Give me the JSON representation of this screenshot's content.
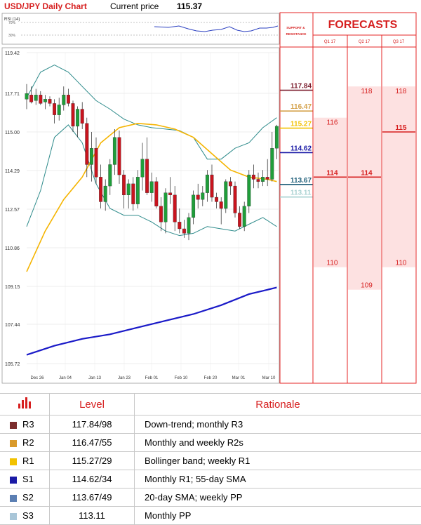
{
  "header": {
    "title": "USD/JPY Daily Chart",
    "price_label": "Current price",
    "price_value": "115.37"
  },
  "rsi_label": "RSI (14)",
  "rsi_ticks": [
    "70%",
    "30%"
  ],
  "sr_header": "SUPPORT & RESISTANCE",
  "forecast_title": "FORECASTS",
  "forecast_cols": [
    "Q1 17",
    "Q2 17",
    "Q3 17"
  ],
  "chart_data": {
    "type": "candlestick",
    "y_ticks": [
      "119.42",
      "117.71",
      "115.00",
      "114.29",
      "112.57",
      "110.86",
      "109.15",
      "107.44",
      "105.72"
    ],
    "x_ticks": [
      "Dec 26",
      "Jan 04",
      "Jan 13",
      "Jan 23",
      "Feb 01",
      "Feb 10",
      "Feb 20",
      "Mar 01",
      "Mar 10"
    ],
    "ylim": [
      105.72,
      119.42
    ],
    "series": [
      {
        "name": "Candles",
        "values": [
          [
            117.3,
            118.1,
            116.6,
            117.7
          ],
          [
            117.6,
            118.0,
            117.0,
            117.1
          ],
          [
            117.2,
            117.9,
            116.9,
            117.6
          ],
          [
            117.6,
            117.8,
            116.9,
            117.0
          ],
          [
            117.1,
            117.6,
            116.6,
            117.3
          ],
          [
            117.3,
            117.5,
            116.8,
            117.0
          ],
          [
            117.0,
            117.3,
            115.6,
            116.2
          ],
          [
            116.2,
            117.4,
            115.8,
            116.9
          ],
          [
            116.9,
            118.0,
            116.5,
            117.6
          ],
          [
            117.6,
            117.9,
            116.8,
            117.0
          ],
          [
            117.0,
            117.2,
            115.0,
            115.4
          ],
          [
            115.4,
            116.8,
            114.9,
            116.6
          ],
          [
            116.6,
            117.1,
            115.2,
            115.6
          ],
          [
            115.6,
            116.0,
            114.0,
            114.4
          ],
          [
            114.4,
            115.0,
            113.8,
            114.7
          ],
          [
            114.7,
            114.9,
            113.7,
            114.0
          ],
          [
            114.0,
            114.4,
            112.6,
            112.9
          ],
          [
            112.9,
            113.9,
            112.5,
            113.6
          ],
          [
            113.6,
            114.5,
            113.2,
            114.4
          ],
          [
            114.4,
            115.2,
            114.1,
            114.9
          ],
          [
            114.9,
            115.1,
            113.7,
            114.1
          ],
          [
            114.1,
            114.3,
            112.6,
            113.2
          ],
          [
            113.2,
            113.9,
            112.6,
            113.7
          ],
          [
            113.7,
            114.0,
            112.5,
            112.8
          ],
          [
            112.8,
            114.3,
            112.6,
            114.0
          ],
          [
            114.0,
            114.8,
            113.4,
            114.5
          ],
          [
            114.5,
            114.9,
            113.2,
            113.3
          ],
          [
            113.3,
            114.2,
            112.9,
            113.8
          ],
          [
            113.8,
            114.0,
            112.6,
            112.7
          ],
          [
            112.7,
            113.1,
            111.6,
            112.0
          ],
          [
            112.0,
            113.5,
            111.5,
            113.3
          ],
          [
            113.3,
            114.0,
            112.8,
            113.2
          ],
          [
            113.2,
            113.6,
            111.6,
            112.0
          ],
          [
            112.0,
            112.6,
            111.5,
            111.7
          ],
          [
            111.7,
            112.1,
            111.3,
            111.5
          ],
          [
            111.5,
            112.4,
            111.2,
            112.2
          ],
          [
            112.2,
            113.4,
            111.9,
            113.2
          ],
          [
            113.2,
            113.7,
            112.6,
            113.0
          ],
          [
            113.0,
            113.6,
            112.7,
            113.3
          ],
          [
            113.3,
            114.3,
            112.9,
            114.1
          ],
          [
            114.1,
            114.4,
            112.9,
            113.1
          ],
          [
            113.1,
            113.3,
            112.6,
            112.9
          ],
          [
            112.9,
            113.1,
            111.9,
            112.6
          ],
          [
            112.6,
            113.9,
            112.4,
            113.8
          ],
          [
            113.8,
            114.0,
            113.2,
            113.6
          ],
          [
            113.6,
            113.8,
            112.2,
            112.4
          ],
          [
            112.4,
            112.7,
            111.7,
            111.8
          ],
          [
            111.8,
            112.9,
            111.6,
            112.7
          ],
          [
            112.7,
            114.3,
            112.4,
            114.1
          ],
          [
            114.1,
            114.4,
            113.5,
            113.9
          ],
          [
            113.9,
            114.2,
            113.5,
            113.8
          ],
          [
            113.8,
            114.3,
            113.6,
            114.0
          ],
          [
            114.0,
            114.5,
            113.6,
            113.9
          ],
          [
            113.9,
            115.0,
            113.8,
            114.7
          ],
          [
            114.7,
            115.5,
            114.5,
            115.4
          ]
        ]
      },
      {
        "name": "SMA",
        "values": [
          [
            0,
            109.8
          ],
          [
            4,
            111.6
          ],
          [
            8,
            113.0
          ],
          [
            12,
            114.0
          ],
          [
            16,
            114.8
          ],
          [
            20,
            115.3
          ],
          [
            24,
            115.6
          ],
          [
            28,
            115.5
          ],
          [
            32,
            115.2
          ],
          [
            36,
            114.9
          ],
          [
            40,
            114.6
          ],
          [
            44,
            114.3
          ],
          [
            48,
            114.0
          ],
          [
            52,
            113.9
          ],
          [
            54,
            113.8
          ]
        ]
      },
      {
        "name": "BB upper",
        "values": [
          [
            0,
            117.4
          ],
          [
            3,
            118.6
          ],
          [
            6,
            118.9
          ],
          [
            9,
            118.6
          ],
          [
            12,
            118.0
          ],
          [
            15,
            117.2
          ],
          [
            18,
            116.6
          ],
          [
            21,
            115.9
          ],
          [
            24,
            115.5
          ],
          [
            27,
            115.3
          ],
          [
            30,
            115.2
          ],
          [
            33,
            115.1
          ],
          [
            36,
            114.9
          ],
          [
            39,
            114.5
          ],
          [
            42,
            114.5
          ],
          [
            45,
            114.7
          ],
          [
            48,
            114.8
          ],
          [
            51,
            115.3
          ],
          [
            54,
            116.0
          ]
        ]
      },
      {
        "name": "BB lower",
        "values": [
          [
            0,
            111.8
          ],
          [
            3,
            113.4
          ],
          [
            6,
            114.9
          ],
          [
            9,
            115.5
          ],
          [
            12,
            114.8
          ],
          [
            15,
            113.7
          ],
          [
            18,
            112.6
          ],
          [
            21,
            112.3
          ],
          [
            24,
            112.3
          ],
          [
            27,
            112.0
          ],
          [
            30,
            111.6
          ],
          [
            33,
            111.4
          ],
          [
            36,
            111.5
          ],
          [
            39,
            111.8
          ],
          [
            42,
            111.7
          ],
          [
            45,
            111.6
          ],
          [
            48,
            111.9
          ],
          [
            51,
            112.2
          ],
          [
            54,
            111.8
          ]
        ]
      },
      {
        "name": "Long MA",
        "values": [
          [
            0,
            106.1
          ],
          [
            6,
            106.5
          ],
          [
            12,
            106.8
          ],
          [
            18,
            107.0
          ],
          [
            24,
            107.3
          ],
          [
            30,
            107.6
          ],
          [
            36,
            107.9
          ],
          [
            42,
            108.3
          ],
          [
            48,
            108.8
          ],
          [
            54,
            109.1
          ]
        ]
      }
    ],
    "levels": [
      {
        "value": 117.84,
        "label": "117.84",
        "color": "#7b1d2e"
      },
      {
        "value": 116.47,
        "label": "116.47",
        "color": "#d4a14a"
      },
      {
        "value": 115.27,
        "label": "115.27",
        "color": "#f2c200"
      },
      {
        "value": 114.62,
        "label": "114.62",
        "color": "#1a1aa6"
      },
      {
        "value": 113.67,
        "label": "113.67",
        "color": "#1f5f7a"
      },
      {
        "value": 113.11,
        "label": "113.11",
        "color": "#a9d2d2"
      }
    ]
  },
  "forecasts": [
    {
      "col": "Q1 17",
      "high": "116",
      "mid": "114",
      "low": "110",
      "high_value": 116,
      "mid_value": 114,
      "low_value": 110
    },
    {
      "col": "Q2 17",
      "high": "118",
      "mid": "114",
      "low": "109",
      "high_value": 118,
      "mid_value": 114,
      "low_value": 109
    },
    {
      "col": "Q3 17",
      "high": "118",
      "mid": "115",
      "low": "110",
      "high_value": 118,
      "mid_value": 115,
      "low_value": 110
    }
  ],
  "table": {
    "headers": [
      "Level",
      "Rationale"
    ],
    "rows": [
      {
        "name": "R3",
        "level": "117.84/98",
        "rationale": "Down-trend; monthly R3",
        "color": "#7b2d2d"
      },
      {
        "name": "R2",
        "level": "116.47/55",
        "rationale": "Monthly and weekly R2s",
        "color": "#d99a2b"
      },
      {
        "name": "R1",
        "level": "115.27/29",
        "rationale": "Bollinger band; weekly R1",
        "color": "#f2c200"
      },
      {
        "name": "S1",
        "level": "114.62/34",
        "rationale": "Monthly R1; 55-day SMA",
        "color": "#1a1aa6"
      },
      {
        "name": "S2",
        "level": "113.67/49",
        "rationale": "20-day SMA; weekly PP",
        "color": "#5b7fb3"
      },
      {
        "name": "S3",
        "level": "113.11",
        "rationale": "Monthly PP",
        "color": "#a9c6d8"
      }
    ]
  },
  "colors": {
    "accent_red": "#d61f1f",
    "up_candle": "#1f9e3a",
    "down_candle": "#c8141e",
    "sma": "#f5b400",
    "bollinger": "#2e8b8b",
    "long_ma": "#1a1ac8",
    "forecast_fill": "#fde1e1"
  }
}
